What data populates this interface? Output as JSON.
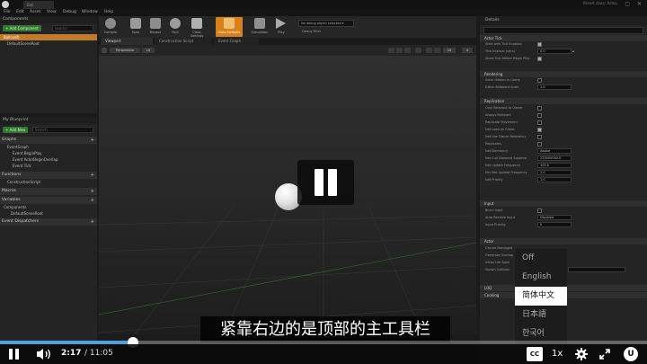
{
  "window": {
    "tab": "Ball",
    "parent_class": "Parent class: Actor",
    "controls": "– ▢ ✕"
  },
  "menu": [
    "File",
    "Edit",
    "Asset",
    "View",
    "Debug",
    "Window",
    "Help"
  ],
  "components_panel": {
    "title": "Components",
    "add_button": "+ Add Component",
    "search_placeholder": "Search",
    "items": [
      "Ball(self)",
      "DefaultSceneRoot"
    ]
  },
  "my_blueprint_panel": {
    "title": "My Blueprint",
    "add_button": "+ Add New",
    "search_placeholder": "Search",
    "categories": {
      "graphs": "Graphs",
      "functions": "Functions",
      "macros": "Macros",
      "variables": "Variables",
      "components": "Components",
      "event_dispatchers": "Event Dispatchers"
    },
    "graph_items": [
      "EventGraph",
      "Event BeginPlay",
      "Event ActorBeginOverlap",
      "Event Tick"
    ],
    "function_items": [
      "ConstructionScript"
    ],
    "component_items": [
      "DefaultSceneRoot"
    ]
  },
  "toolbar": {
    "buttons": [
      "Compile",
      "Save",
      "Browse",
      "Find",
      "Class Settings",
      "Class Defaults",
      "Simulation",
      "Play"
    ],
    "debug_filter": "No debug object selected ▾",
    "debug_label": "Debug Filter"
  },
  "editor_tabs": [
    "Viewport",
    "Construction Script",
    "Event Graph"
  ],
  "viewport": {
    "view_mode": "Perspective",
    "lighting": "Lit",
    "snap_value": "10",
    "camera_speed": "4"
  },
  "details": {
    "title": "Details",
    "sections": {
      "actor_tick": "Actor Tick",
      "rendering": "Rendering",
      "replication": "Replication",
      "input": "Input",
      "actor": "Actor",
      "lod": "LOD",
      "cooking": "Cooking"
    },
    "actor_tick_props": [
      "Start with Tick Enabled",
      "Tick Interval (secs)",
      "Allow Tick Before Begin Play"
    ],
    "tick_interval": "0.0",
    "rendering_props": [
      "Actor Hidden In Game",
      "Editor Billboard Scale"
    ],
    "billboard_scale": "1.0",
    "replication_props": [
      "Only Relevant to Owner",
      "Always Relevant",
      "Replicate Movement",
      "Net Load on Client",
      "Net Use Owner Relevancy",
      "Replicates",
      "Net Dormancy",
      "Net Cull Distance Squared",
      "Net Update Frequency",
      "Min Net Update Frequency",
      "Net Priority"
    ],
    "net_dormancy": "Awake",
    "net_cull": "225000000.0",
    "net_update": "100.0",
    "min_net_update": "2.0",
    "net_priority": "1.0",
    "input_props": [
      "Block Input",
      "Auto Receive Input",
      "Input Priority"
    ],
    "auto_receive": "Disabled",
    "input_priority": "0",
    "actor_props": [
      "Can be Damaged",
      "Generate Overlap",
      "Initial Life Span",
      "Spawn Collision"
    ]
  },
  "subtitle": "紧靠右边的是顶部的主工具栏",
  "caption_menu": {
    "options": [
      "Off",
      "English",
      "简体中文",
      "日本語",
      "한국어"
    ],
    "selected": 2
  },
  "player": {
    "current_time": "2:17",
    "total_time": "/ 11:05",
    "progress": 0.206,
    "cc_label": "CC",
    "speed": "1x",
    "brand_letter": "U",
    "accent_color": "#4aa3df"
  }
}
